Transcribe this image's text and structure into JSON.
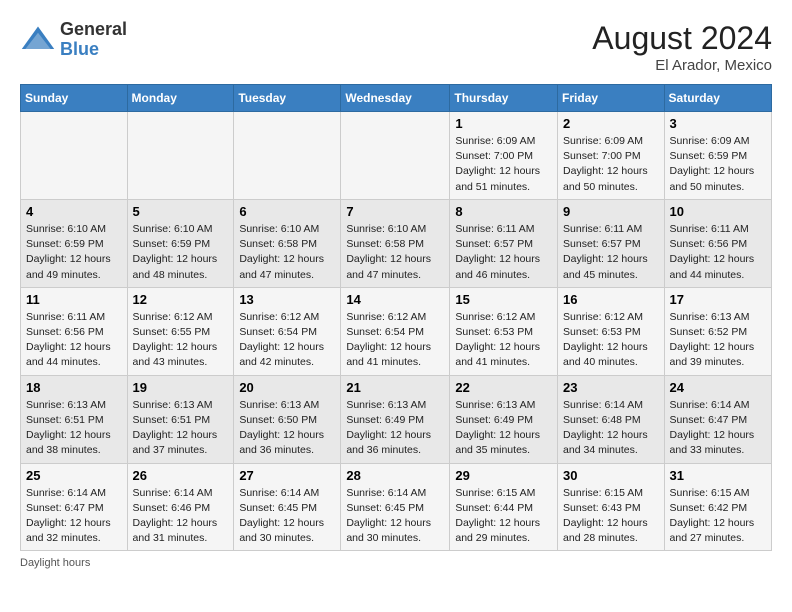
{
  "header": {
    "logo": {
      "general": "General",
      "blue": "Blue"
    },
    "month_year": "August 2024",
    "location": "El Arador, Mexico"
  },
  "days_of_week": [
    "Sunday",
    "Monday",
    "Tuesday",
    "Wednesday",
    "Thursday",
    "Friday",
    "Saturday"
  ],
  "weeks": [
    [
      {
        "day": "",
        "info": ""
      },
      {
        "day": "",
        "info": ""
      },
      {
        "day": "",
        "info": ""
      },
      {
        "day": "",
        "info": ""
      },
      {
        "day": "1",
        "info": "Sunrise: 6:09 AM\nSunset: 7:00 PM\nDaylight: 12 hours\nand 51 minutes."
      },
      {
        "day": "2",
        "info": "Sunrise: 6:09 AM\nSunset: 7:00 PM\nDaylight: 12 hours\nand 50 minutes."
      },
      {
        "day": "3",
        "info": "Sunrise: 6:09 AM\nSunset: 6:59 PM\nDaylight: 12 hours\nand 50 minutes."
      }
    ],
    [
      {
        "day": "4",
        "info": "Sunrise: 6:10 AM\nSunset: 6:59 PM\nDaylight: 12 hours\nand 49 minutes."
      },
      {
        "day": "5",
        "info": "Sunrise: 6:10 AM\nSunset: 6:59 PM\nDaylight: 12 hours\nand 48 minutes."
      },
      {
        "day": "6",
        "info": "Sunrise: 6:10 AM\nSunset: 6:58 PM\nDaylight: 12 hours\nand 47 minutes."
      },
      {
        "day": "7",
        "info": "Sunrise: 6:10 AM\nSunset: 6:58 PM\nDaylight: 12 hours\nand 47 minutes."
      },
      {
        "day": "8",
        "info": "Sunrise: 6:11 AM\nSunset: 6:57 PM\nDaylight: 12 hours\nand 46 minutes."
      },
      {
        "day": "9",
        "info": "Sunrise: 6:11 AM\nSunset: 6:57 PM\nDaylight: 12 hours\nand 45 minutes."
      },
      {
        "day": "10",
        "info": "Sunrise: 6:11 AM\nSunset: 6:56 PM\nDaylight: 12 hours\nand 44 minutes."
      }
    ],
    [
      {
        "day": "11",
        "info": "Sunrise: 6:11 AM\nSunset: 6:56 PM\nDaylight: 12 hours\nand 44 minutes."
      },
      {
        "day": "12",
        "info": "Sunrise: 6:12 AM\nSunset: 6:55 PM\nDaylight: 12 hours\nand 43 minutes."
      },
      {
        "day": "13",
        "info": "Sunrise: 6:12 AM\nSunset: 6:54 PM\nDaylight: 12 hours\nand 42 minutes."
      },
      {
        "day": "14",
        "info": "Sunrise: 6:12 AM\nSunset: 6:54 PM\nDaylight: 12 hours\nand 41 minutes."
      },
      {
        "day": "15",
        "info": "Sunrise: 6:12 AM\nSunset: 6:53 PM\nDaylight: 12 hours\nand 41 minutes."
      },
      {
        "day": "16",
        "info": "Sunrise: 6:12 AM\nSunset: 6:53 PM\nDaylight: 12 hours\nand 40 minutes."
      },
      {
        "day": "17",
        "info": "Sunrise: 6:13 AM\nSunset: 6:52 PM\nDaylight: 12 hours\nand 39 minutes."
      }
    ],
    [
      {
        "day": "18",
        "info": "Sunrise: 6:13 AM\nSunset: 6:51 PM\nDaylight: 12 hours\nand 38 minutes."
      },
      {
        "day": "19",
        "info": "Sunrise: 6:13 AM\nSunset: 6:51 PM\nDaylight: 12 hours\nand 37 minutes."
      },
      {
        "day": "20",
        "info": "Sunrise: 6:13 AM\nSunset: 6:50 PM\nDaylight: 12 hours\nand 36 minutes."
      },
      {
        "day": "21",
        "info": "Sunrise: 6:13 AM\nSunset: 6:49 PM\nDaylight: 12 hours\nand 36 minutes."
      },
      {
        "day": "22",
        "info": "Sunrise: 6:13 AM\nSunset: 6:49 PM\nDaylight: 12 hours\nand 35 minutes."
      },
      {
        "day": "23",
        "info": "Sunrise: 6:14 AM\nSunset: 6:48 PM\nDaylight: 12 hours\nand 34 minutes."
      },
      {
        "day": "24",
        "info": "Sunrise: 6:14 AM\nSunset: 6:47 PM\nDaylight: 12 hours\nand 33 minutes."
      }
    ],
    [
      {
        "day": "25",
        "info": "Sunrise: 6:14 AM\nSunset: 6:47 PM\nDaylight: 12 hours\nand 32 minutes."
      },
      {
        "day": "26",
        "info": "Sunrise: 6:14 AM\nSunset: 6:46 PM\nDaylight: 12 hours\nand 31 minutes."
      },
      {
        "day": "27",
        "info": "Sunrise: 6:14 AM\nSunset: 6:45 PM\nDaylight: 12 hours\nand 30 minutes."
      },
      {
        "day": "28",
        "info": "Sunrise: 6:14 AM\nSunset: 6:45 PM\nDaylight: 12 hours\nand 30 minutes."
      },
      {
        "day": "29",
        "info": "Sunrise: 6:15 AM\nSunset: 6:44 PM\nDaylight: 12 hours\nand 29 minutes."
      },
      {
        "day": "30",
        "info": "Sunrise: 6:15 AM\nSunset: 6:43 PM\nDaylight: 12 hours\nand 28 minutes."
      },
      {
        "day": "31",
        "info": "Sunrise: 6:15 AM\nSunset: 6:42 PM\nDaylight: 12 hours\nand 27 minutes."
      }
    ]
  ],
  "footer": {
    "note": "Daylight hours"
  }
}
